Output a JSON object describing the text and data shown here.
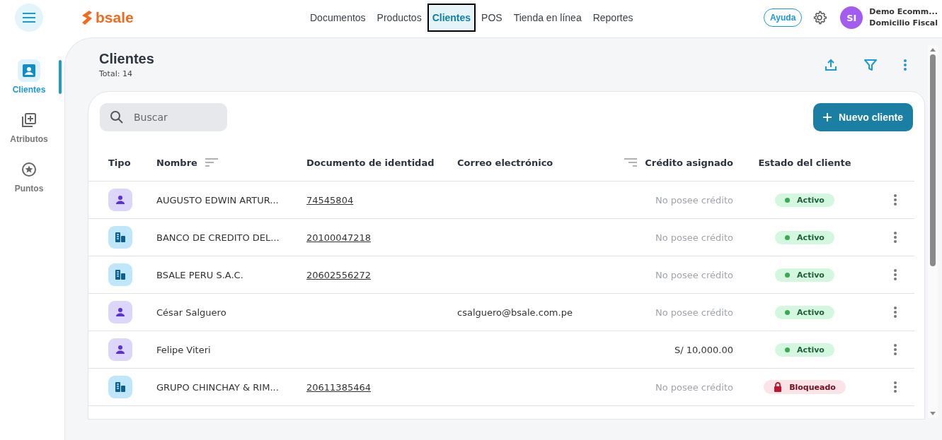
{
  "brand": "bsale",
  "nav": [
    {
      "label": "Documentos",
      "selected": false
    },
    {
      "label": "Productos",
      "selected": false
    },
    {
      "label": "Clientes",
      "selected": true
    },
    {
      "label": "POS",
      "selected": false
    },
    {
      "label": "Tienda en línea",
      "selected": false
    },
    {
      "label": "Reportes",
      "selected": false
    }
  ],
  "help_button": "Ayuda",
  "user": {
    "initials": "SI",
    "name": "Demo Ecomm...",
    "branch": "Domicilio Fiscal"
  },
  "sidebar": [
    {
      "label": "Clientes",
      "kind": "clients",
      "selected": true
    },
    {
      "label": "Atributos",
      "kind": "attributes",
      "selected": false
    },
    {
      "label": "Puntos",
      "kind": "points",
      "selected": false
    }
  ],
  "page": {
    "title": "Clientes",
    "total": "Total: 14"
  },
  "search": {
    "placeholder": "Buscar"
  },
  "new_button": "Nuevo cliente",
  "columns": [
    "Tipo",
    "Nombre",
    "Documento de identidad",
    "Correo electrónico",
    "Crédito asignado",
    "Estado del cliente"
  ],
  "rows": [
    {
      "kind": "person",
      "name": "AUGUSTO EDWIN ARTUR...",
      "document": "74545804",
      "credit": "No posee crédito",
      "has_credit": false,
      "status": "Activo",
      "blocked": false
    },
    {
      "kind": "company",
      "name": "BANCO DE CREDITO DEL...",
      "document": "20100047218",
      "credit": "No posee crédito",
      "has_credit": false,
      "status": "Activo",
      "blocked": false
    },
    {
      "kind": "company",
      "name": "BSALE PERU S.A.C.",
      "document": "20602556272",
      "credit": "No posee crédito",
      "has_credit": false,
      "status": "Activo",
      "blocked": false
    },
    {
      "kind": "person",
      "name": "César Salguero",
      "email": "csalguero@bsale.com.pe",
      "credit": "No posee crédito",
      "has_credit": false,
      "status": "Activo",
      "blocked": false
    },
    {
      "kind": "person",
      "name": "Felipe Viteri",
      "credit": "S/ 10,000.00",
      "has_credit": true,
      "status": "Activo",
      "blocked": false
    },
    {
      "kind": "company",
      "name": "GRUPO CHINCHAY & RIM...",
      "document": "20611385464",
      "credit": "No posee crédito",
      "has_credit": false,
      "status": "Bloqueado",
      "blocked": true
    }
  ]
}
